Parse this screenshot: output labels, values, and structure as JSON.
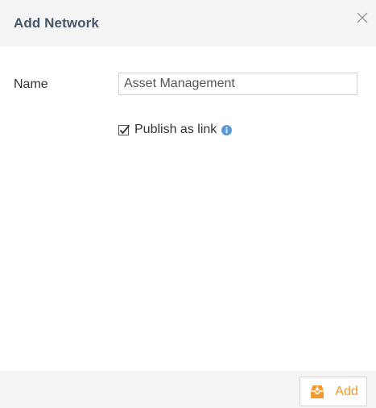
{
  "dialog": {
    "title": "Add Network",
    "close_icon": "close-icon"
  },
  "form": {
    "name_label": "Name",
    "name_value": "Asset Management",
    "publish_label": "Publish as link",
    "publish_checked": true,
    "info_icon": "info-icon"
  },
  "footer": {
    "add_label": "Add",
    "add_icon": "inbox-download-icon"
  },
  "colors": {
    "title": "#45576a",
    "accent": "#f29a2e",
    "info": "#5b9bd5",
    "header_bg": "#f5f5f5"
  }
}
